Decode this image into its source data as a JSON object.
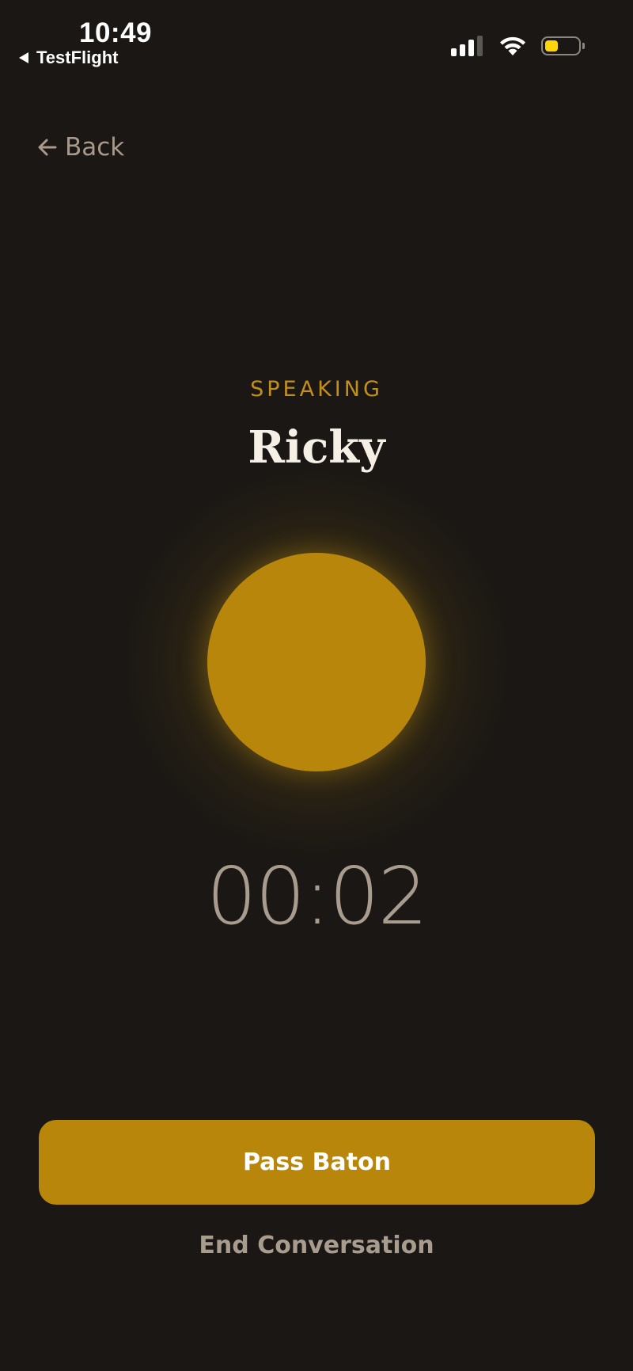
{
  "status_bar": {
    "time": "10:49",
    "back_app": "TestFlight",
    "battery_level": 0.4,
    "icons": [
      "cellular-signal-icon",
      "wifi-icon",
      "battery-icon"
    ]
  },
  "nav": {
    "back_label": "Back"
  },
  "session": {
    "state_label": "SPEAKING",
    "speaker_name": "Ricky",
    "timer": "00:02"
  },
  "actions": {
    "pass_baton_label": "Pass Baton",
    "end_conversation_label": "End Conversation"
  },
  "colors": {
    "background": "#1a1714",
    "accent": "#b8860b",
    "label_accent": "#c38f1a",
    "muted_text": "#a89c8e",
    "name_text": "#f5efe6",
    "battery_fill": "#ffd60a"
  }
}
